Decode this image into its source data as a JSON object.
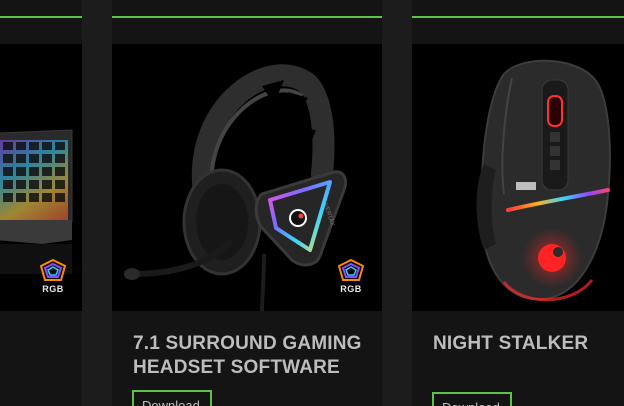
{
  "products": [
    {
      "id": "keyboard",
      "title": "",
      "image_icon": "rgb-keyboard-image",
      "badge": "RGB"
    },
    {
      "id": "headset",
      "title": "7.1 SURROUND GAMING HEADSET SOFTWARE",
      "image_icon": "gaming-headset-image",
      "badge": "RGB",
      "button_label": "Download"
    },
    {
      "id": "mouse",
      "title": "NIGHT STALKER",
      "image_icon": "gaming-mouse-image",
      "button_label": "Download"
    }
  ],
  "colors": {
    "accent": "#5ec24a",
    "page_bg": "#1c1c1c",
    "card_bg": "#141414",
    "title_text": "#bdbdbd"
  }
}
